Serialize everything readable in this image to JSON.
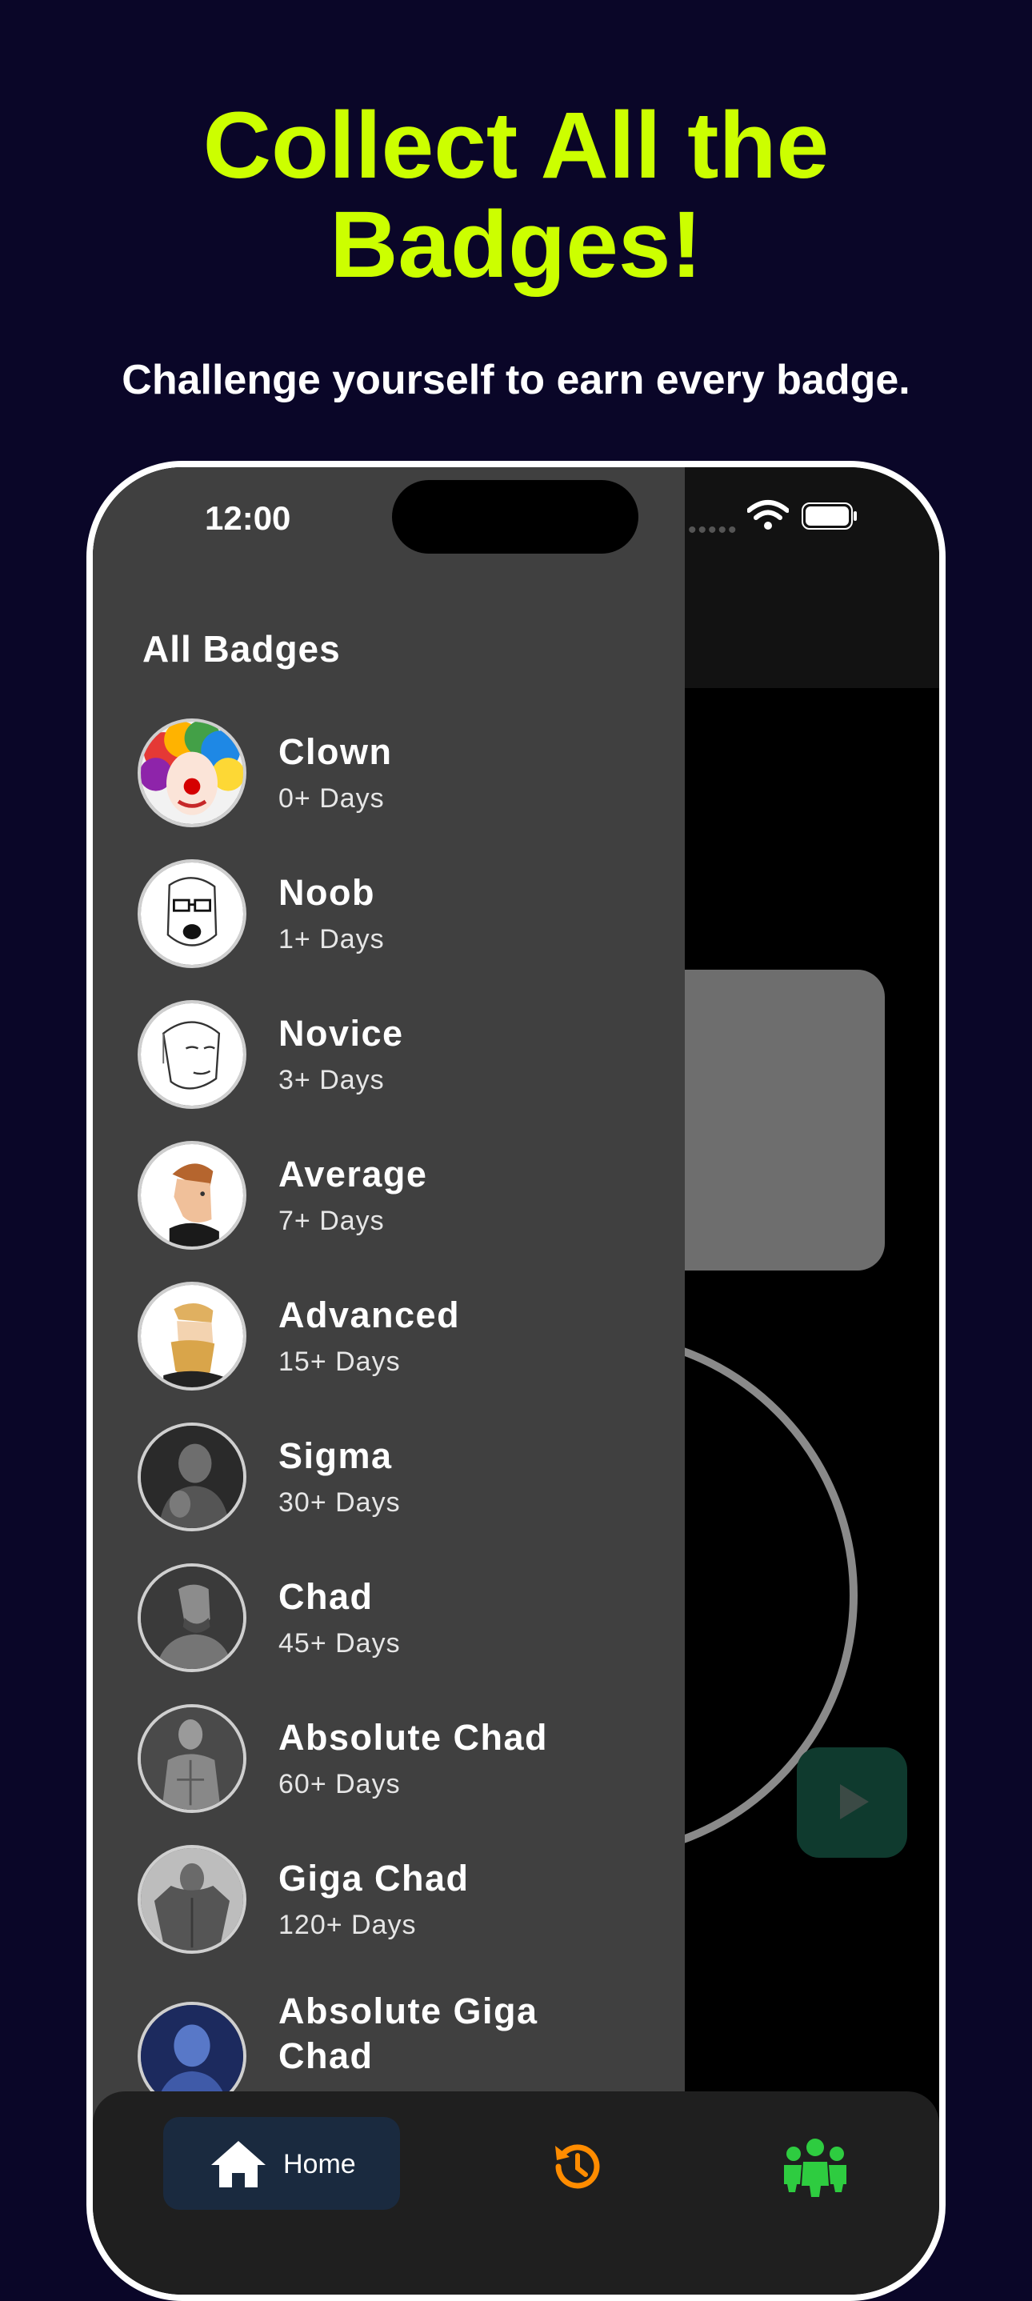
{
  "promo": {
    "headline_line1": "Collect All the",
    "headline_line2": "Badges!",
    "subheadline": "Challenge yourself to earn every badge."
  },
  "status_bar": {
    "time": "12:00",
    "dots": "•••••"
  },
  "drawer": {
    "title": "All Badges",
    "badges": [
      {
        "name": "Clown",
        "days": "0+ Days",
        "icon": "clown-avatar"
      },
      {
        "name": "Noob",
        "days": "1+ Days",
        "icon": "noob-wojak-avatar"
      },
      {
        "name": "Novice",
        "days": "3+ Days",
        "icon": "novice-wojak-avatar"
      },
      {
        "name": "Average",
        "days": "7+ Days",
        "icon": "average-man-avatar"
      },
      {
        "name": "Advanced",
        "days": "15+ Days",
        "icon": "advanced-bearded-avatar"
      },
      {
        "name": "Sigma",
        "days": "30+ Days",
        "icon": "sigma-photo-avatar"
      },
      {
        "name": "Chad",
        "days": "45+ Days",
        "icon": "chad-photo-avatar"
      },
      {
        "name": "Absolute Chad",
        "days": "60+ Days",
        "icon": "absolute-chad-photo-avatar"
      },
      {
        "name": "Giga Chad",
        "days": "120+ Days",
        "icon": "giga-chad-photo-avatar"
      },
      {
        "name": "Absolute Giga Chad",
        "days": "",
        "icon": "absolute-giga-chad-avatar"
      }
    ]
  },
  "bottom_nav": {
    "home_label": "Home",
    "home_icon": "home-icon",
    "history_icon": "history-icon",
    "group_icon": "group-icon",
    "colors": {
      "home_bg": "#1a2a3f",
      "history": "#ff8c00",
      "group": "#2ecc40"
    }
  },
  "colors": {
    "page_bg": "#0a0628",
    "headline": "#ccff00",
    "drawer_bg": "#404040"
  }
}
